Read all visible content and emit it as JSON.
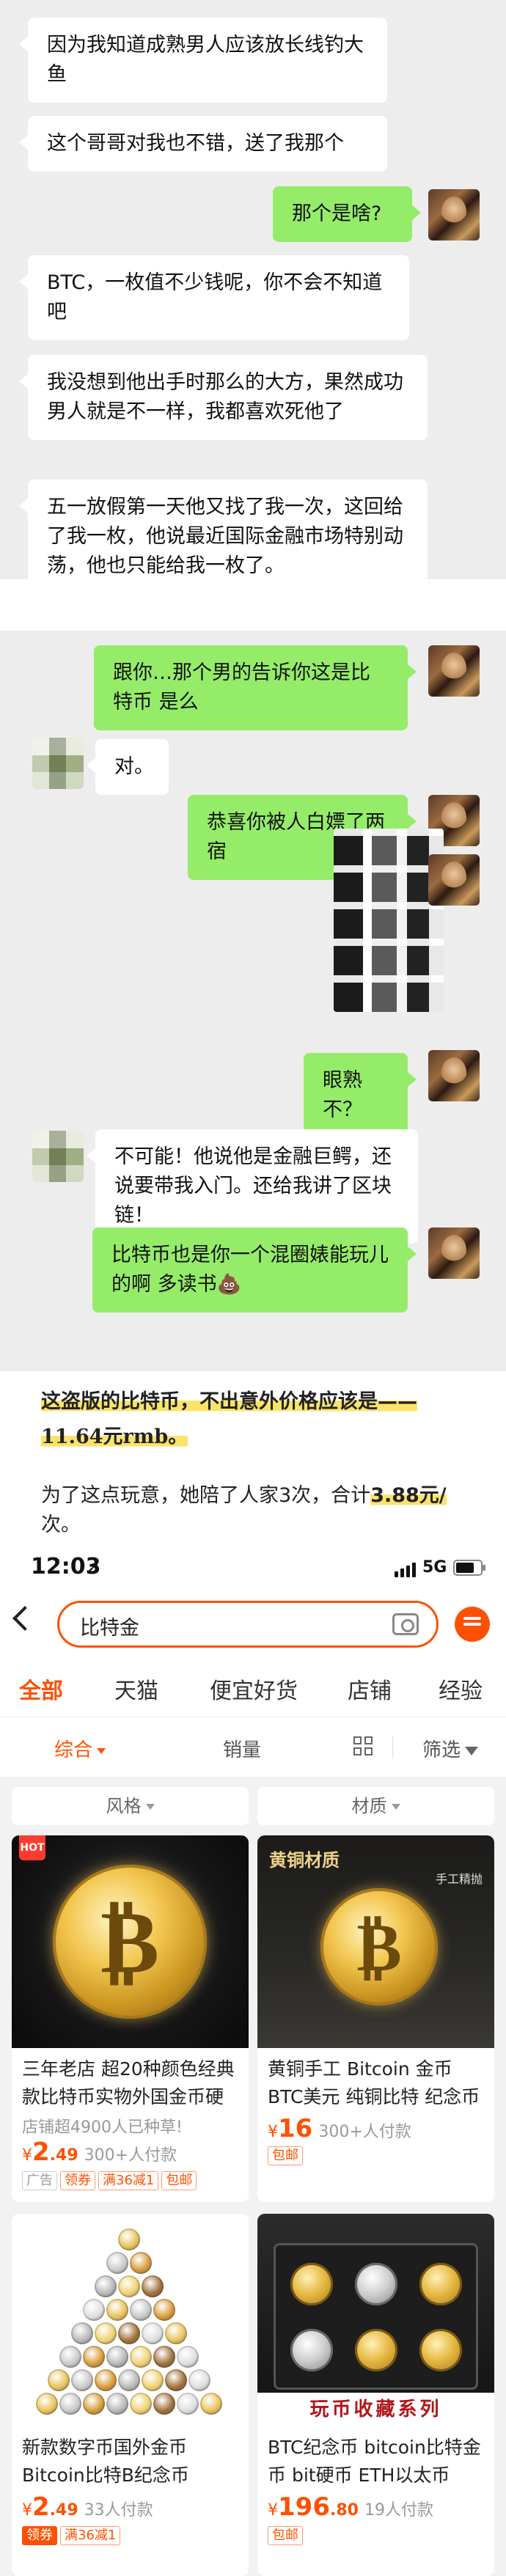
{
  "chat1": {
    "messages": [
      {
        "side": "left",
        "text": "因为我知道成熟男人应该放长线钓大鱼"
      },
      {
        "side": "left",
        "text": "这个哥哥对我也不错，送了我那个"
      },
      {
        "side": "right",
        "text": "那个是啥?"
      },
      {
        "side": "left",
        "text": "BTC，一枚值不少钱呢，你不会不知道吧"
      },
      {
        "side": "left",
        "text": "我没想到他出手时那么的大方，果然成功男人就是不一样，我都喜欢死他了"
      },
      {
        "side": "left",
        "text": "五一放假第一天他又找了我一次，这回给了我一枚，他说最近国际金融市场特别动荡，他也只能给我一枚了。"
      }
    ]
  },
  "chat2": {
    "messages": [
      {
        "side": "right",
        "text": "跟你…那个男的告诉你这是比特币 是么"
      },
      {
        "side": "left",
        "text": "对。"
      },
      {
        "side": "right",
        "text": "恭喜你被人白嫖了两宿"
      },
      {
        "side": "right",
        "text": "眼熟不？"
      },
      {
        "side": "left",
        "text": "不可能！他说他是金融巨鳄，还说要带我入门。还给我讲了区块链！"
      },
      {
        "side": "right",
        "text": "比特币也是你一个混圈婊能玩儿的啊 多读书💩"
      }
    ]
  },
  "article": {
    "line1": "这盗版的比特币，不出意外价格应该是——",
    "line2": "11.64元rmb。",
    "line3_a": "为了这点玩意，她陪了人家3次，合计",
    "line3_b": "3.88元/",
    "line4": "次。"
  },
  "shop": {
    "status": {
      "time": "12:03",
      "network": "5G",
      "battery_level": 0.75
    },
    "search": {
      "query": "比特金"
    },
    "tabs": [
      "全部",
      "天猫",
      "便宜好货",
      "店铺",
      "经验"
    ],
    "active_tab": 0,
    "sort": {
      "comprehensive": "综合",
      "sales": "销量",
      "filter": "筛选"
    },
    "chips": [
      "风格",
      "材质"
    ],
    "products": [
      {
        "hot": "HOT",
        "title": "三年老店 超20种颜色经典款比特币实物外国金币硬",
        "meta": "店铺超4900人已种草!",
        "price_int": "2",
        "price_dec": ".49",
        "sold": "300+人付款",
        "tags": [
          "广告",
          "领券",
          "满36减1",
          "包邮"
        ]
      },
      {
        "image_label": "黄铜材质",
        "image_sub": "手工精抛",
        "title": "黄铜手工 Bitcoin 金币BTC美元 纯铜比特 纪念币",
        "price_int": "16",
        "price_dec": "",
        "sold": "300+人付款",
        "tags": [
          "包邮"
        ]
      },
      {
        "title": "新款数字币国外金币Bitcoin比特B纪念币",
        "price_int": "2",
        "price_dec": ".49",
        "sold": "33人付款",
        "tags": [
          "领券",
          "满36减1"
        ]
      },
      {
        "image_label": "玩币收藏系列",
        "title": "BTC纪念币 bitcoin比特金币 bit硬币 ETH以太币",
        "price_int": "196",
        "price_dec": ".80",
        "sold": "19人付款",
        "tags": [
          "包邮"
        ]
      }
    ],
    "currency": "¥"
  }
}
